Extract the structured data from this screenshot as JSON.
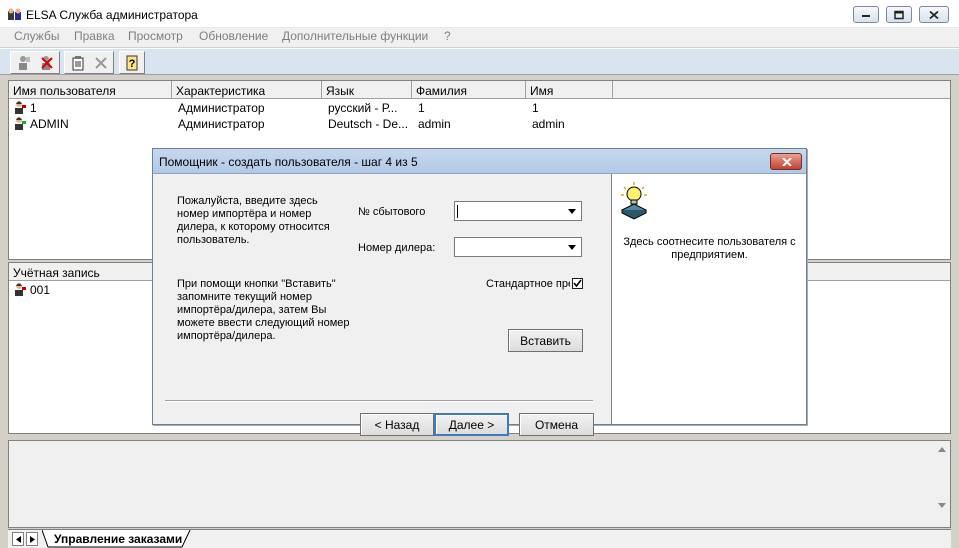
{
  "window": {
    "title": "ELSA Служба администратора",
    "accent": "#d9e4f1"
  },
  "menu": {
    "items": [
      "Службы",
      "Правка",
      "Просмотр",
      "Обновление",
      "Дополнительные функции",
      "?"
    ]
  },
  "toolbar": {
    "icons": [
      "user-icon",
      "delete-user-icon",
      "paste-icon",
      "close-x-icon",
      "help-icon"
    ]
  },
  "users_table": {
    "columns": [
      "Имя пользователя",
      "Характеристика",
      "Язык",
      "Фамилия",
      "Имя"
    ],
    "rows": [
      [
        "1",
        "Администратор",
        "русский - Р...",
        "1",
        "1"
      ],
      [
        "ADMIN",
        "Администратор",
        "Deutsch - De...",
        "admin",
        "admin"
      ]
    ]
  },
  "accounts_table": {
    "column": "Учётная запись",
    "rows": [
      "001"
    ]
  },
  "dialog": {
    "title": "Помощник - создать пользователя - шаг 4 из 5",
    "intro_text": "Пожалуйста, введите здесь номер импортёра и номер дилера, к которому относится пользователь.",
    "importer_label": "№ сбытового",
    "dealer_label": "Номер дилера:",
    "importer_value": "",
    "dealer_value": "",
    "help_text": "При помощи кнопки \"Вставить\" запомните текущий номер импортёра/дилера, затем Вы можете ввести следующий  номер импортёра/дилера.",
    "standard_label": "Стандартное пре",
    "standard_checked": true,
    "insert_button": "Вставить",
    "back_button": "< Назад",
    "next_button": "Далее >",
    "cancel_button": "Отмена",
    "side_text": "Здесь соотнесите пользователя с предприятием."
  },
  "tabs": {
    "active": "Управление заказами"
  }
}
